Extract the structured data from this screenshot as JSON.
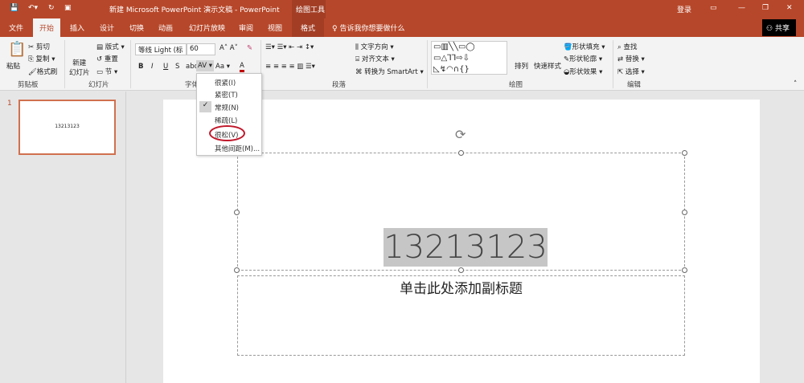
{
  "titlebar": {
    "title": "新建 Microsoft PowerPoint 演示文稿 - PowerPoint",
    "context": "绘图工具",
    "login": "登录",
    "save_icon": "save-icon",
    "undo_icon": "undo-icon",
    "redo_icon": "redo-icon"
  },
  "tabs": [
    {
      "label": "文件"
    },
    {
      "label": "开始"
    },
    {
      "label": "插入"
    },
    {
      "label": "设计"
    },
    {
      "label": "切换"
    },
    {
      "label": "动画"
    },
    {
      "label": "幻灯片放映"
    },
    {
      "label": "审阅"
    },
    {
      "label": "视图"
    },
    {
      "label": "格式"
    }
  ],
  "tell_me": "告诉我你想要做什么",
  "share": "共享",
  "clipboard": {
    "paste": "粘贴",
    "cut": "剪切",
    "copy": "复制",
    "format_painter": "格式刷",
    "group": "剪贴板"
  },
  "slides": {
    "new_slide": "新建\n幻灯片",
    "layout": "版式",
    "reset": "重置",
    "section": "节",
    "group": "幻灯片"
  },
  "font": {
    "name": "等线 Light (标",
    "size": "60",
    "bold": "B",
    "italic": "I",
    "underline": "U",
    "shadow": "S",
    "strike": "abc",
    "spacing": "AV",
    "case": "Aa",
    "color": "A",
    "group": "字体",
    "accent": "#c00000"
  },
  "paragraph": {
    "text_direction": "文字方向",
    "align_text": "对齐文本",
    "smartart": "转换为 SmartArt",
    "group": "段落"
  },
  "drawing": {
    "arrange": "排列",
    "quick_styles": "快速样式",
    "fill": "形状填充",
    "outline": "形状轮廓",
    "effects": "形状效果",
    "group": "绘图"
  },
  "editing": {
    "find": "查找",
    "replace": "替换",
    "select": "选择",
    "group": "编辑"
  },
  "spacing_menu": {
    "items": [
      {
        "label": "很紧(I)"
      },
      {
        "label": "紧密(T)"
      },
      {
        "label": "常规(N)",
        "checked": true
      },
      {
        "label": "稀疏(L)"
      },
      {
        "label": "很松(V)",
        "highlighted": true
      },
      {
        "label": "其他间距(M)..."
      }
    ]
  },
  "thumbnail": {
    "number": "1",
    "text": "13213123"
  },
  "slide": {
    "title": "13213123",
    "subtitle": "单击此处添加副标题"
  },
  "colors": {
    "brand": "#b7472a",
    "highlight_circle": "#c0182a"
  }
}
